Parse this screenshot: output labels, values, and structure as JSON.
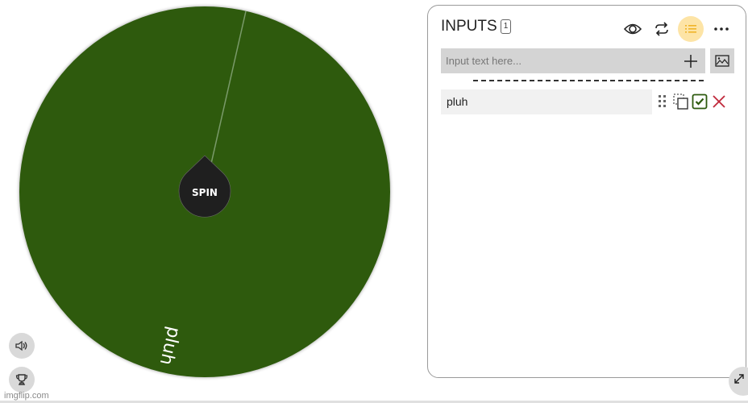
{
  "wheel": {
    "spin_label": "SPIN",
    "segments": [
      {
        "label": "pluh",
        "color": "#2d5a0e"
      }
    ],
    "text_color": "#ffffff",
    "hub_color": "#1f1f1f"
  },
  "controls": {
    "sound_icon": "speaker-icon",
    "trophy_icon": "trophy-icon",
    "expand_icon": "expand-icon"
  },
  "watermark": "imgflip.com",
  "panel": {
    "title": "INPUTS",
    "count": "1",
    "header_icons": [
      "eye-icon",
      "shuffle-icon",
      "list-icon",
      "more-icon"
    ],
    "active_icon_color": "#fde4a6",
    "input": {
      "placeholder": "Input text here...",
      "value": ""
    },
    "entries": [
      {
        "label": "pluh",
        "checked": true
      }
    ],
    "check_color": "#2d5a0e",
    "delete_color": "#c0283a"
  }
}
